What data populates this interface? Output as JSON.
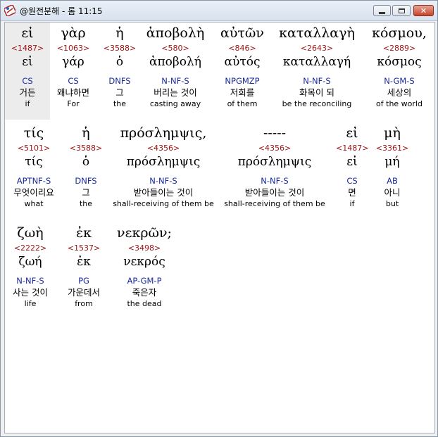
{
  "window": {
    "title": "@원전분해 - 롬 11:15"
  },
  "rows": [
    {
      "words": [
        {
          "greek": "εἰ",
          "strongs": "<1487>",
          "lexeme": "εἰ",
          "parse": "CS",
          "korean": "거든",
          "english": "if"
        },
        {
          "greek": "γὰρ",
          "strongs": "<1063>",
          "lexeme": "γάρ",
          "parse": "CS",
          "korean": "왜냐하면",
          "english": "For"
        },
        {
          "greek": "ἡ",
          "strongs": "<3588>",
          "lexeme": "ὁ",
          "parse": "DNFS",
          "korean": "그",
          "english": "the"
        },
        {
          "greek": "ἀποβολὴ",
          "strongs": "<580>",
          "lexeme": "ἀποβολή",
          "parse": "N-NF-S",
          "korean": "버리는 것이",
          "english": "casting away"
        },
        {
          "greek": "αὐτῶν",
          "strongs": "<846>",
          "lexeme": "αὐτός",
          "parse": "NPGMZP",
          "korean": "저희를",
          "english": "of them"
        },
        {
          "greek": "καταλλαγὴ",
          "strongs": "<2643>",
          "lexeme": "καταλλαγή",
          "parse": "N-NF-S",
          "korean": "화목이 되",
          "english": "be the reconciling"
        },
        {
          "greek": "κόσμου,",
          "strongs": "<2889>",
          "lexeme": "κόσμος",
          "parse": "N-GM-S",
          "korean": "세상의",
          "english": "of the world"
        }
      ]
    },
    {
      "words": [
        {
          "greek": "τίς",
          "strongs": "<5101>",
          "lexeme": "τίς",
          "parse": "APTNF-S",
          "korean": "무엇이리요",
          "english": "what"
        },
        {
          "greek": "ἡ",
          "strongs": "<3588>",
          "lexeme": "ὁ",
          "parse": "DNFS",
          "korean": "그",
          "english": "the"
        },
        {
          "greek": "πρόσλημψις,",
          "strongs": "<4356>",
          "lexeme": "πρόσλημψις",
          "parse": "N-NF-S",
          "korean": "받아들이는 것이",
          "english": "shall-receiving of them be"
        },
        {
          "greek": "-----",
          "strongs": "<4356>",
          "lexeme": "πρόσλημψις",
          "parse": "N-NF-S",
          "korean": "받아들이는 것이",
          "english": "shall-receiving of them be"
        },
        {
          "greek": "εἰ",
          "strongs": "<1487>",
          "lexeme": "εἰ",
          "parse": "CS",
          "korean": "면",
          "english": "if"
        },
        {
          "greek": "μὴ",
          "strongs": "<3361>",
          "lexeme": "μή",
          "parse": "AB",
          "korean": "아니",
          "english": "but"
        }
      ]
    },
    {
      "words": [
        {
          "greek": "ζωὴ",
          "strongs": "<2222>",
          "lexeme": "ζωή",
          "parse": "N-NF-S",
          "korean": "사는 것이",
          "english": "life"
        },
        {
          "greek": "ἐκ",
          "strongs": "<1537>",
          "lexeme": "ἐκ",
          "parse": "PG",
          "korean": "가운데서",
          "english": "from"
        },
        {
          "greek": "νεκρῶν;",
          "strongs": "<3498>",
          "lexeme": "νεκρός",
          "parse": "AP-GM-P",
          "korean": "죽은자",
          "english": "the dead"
        }
      ]
    }
  ]
}
